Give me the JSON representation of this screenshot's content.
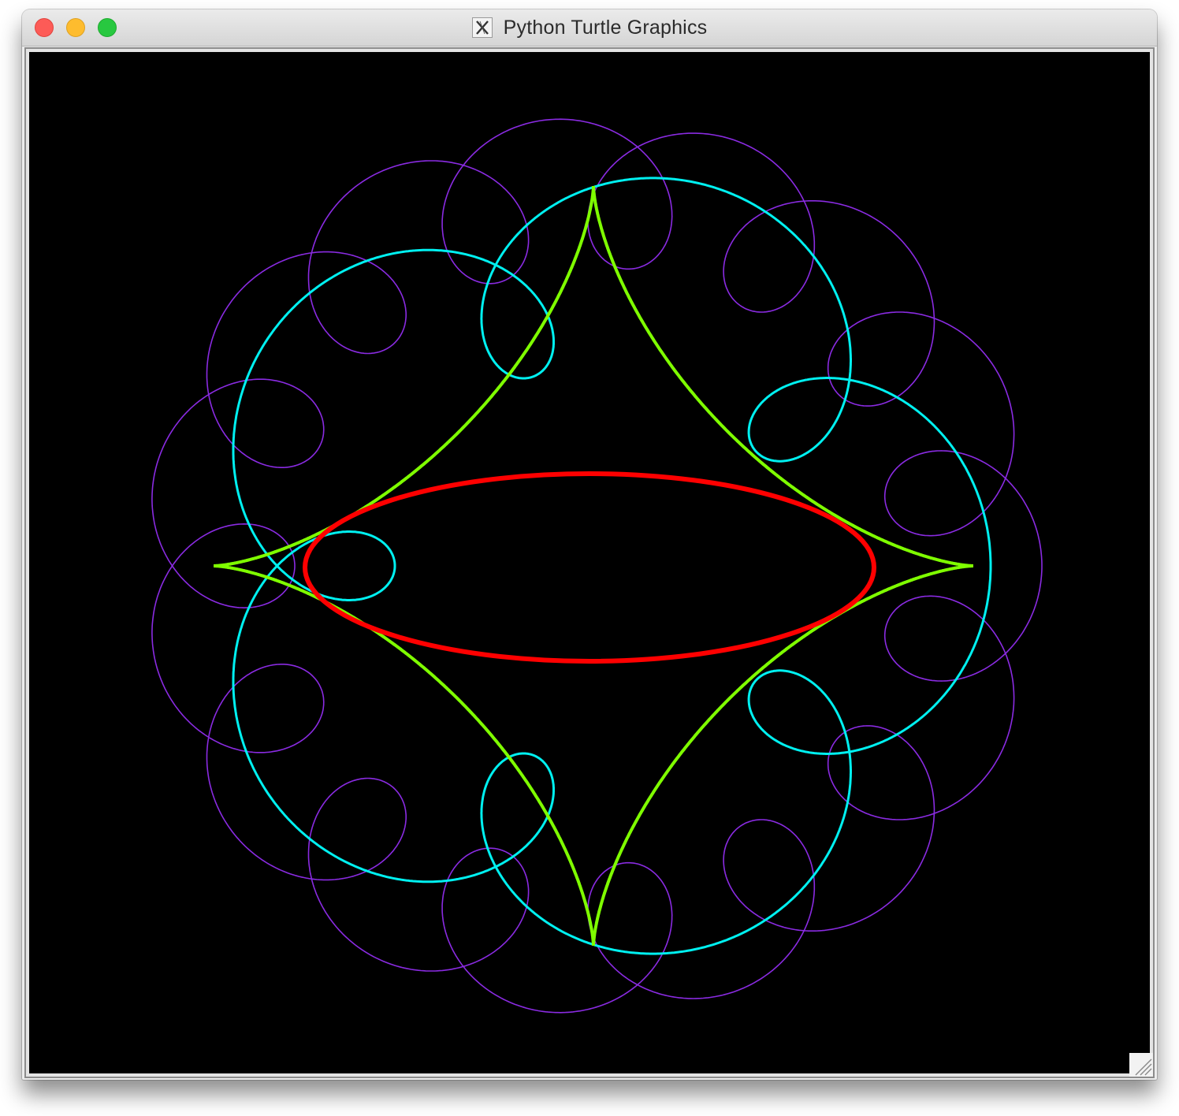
{
  "window": {
    "title": "Python Turtle Graphics",
    "app_icon": "x11-icon",
    "controls": [
      "close-button",
      "minimize-button",
      "maximize-button"
    ]
  },
  "canvas": {
    "background": "#000000",
    "curves": [
      {
        "name": "violet-loops",
        "color": "#8a2be2",
        "shape": "epitrochoid, 16 loops"
      },
      {
        "name": "cyan-loops",
        "color": "#00f0f0",
        "shape": "epitrochoid, 6 loops"
      },
      {
        "name": "green-astroid",
        "color": "#7fff00",
        "shape": "4-cusp star"
      },
      {
        "name": "red-ellipse",
        "color": "#ff0000",
        "shape": "ellipse"
      }
    ]
  }
}
